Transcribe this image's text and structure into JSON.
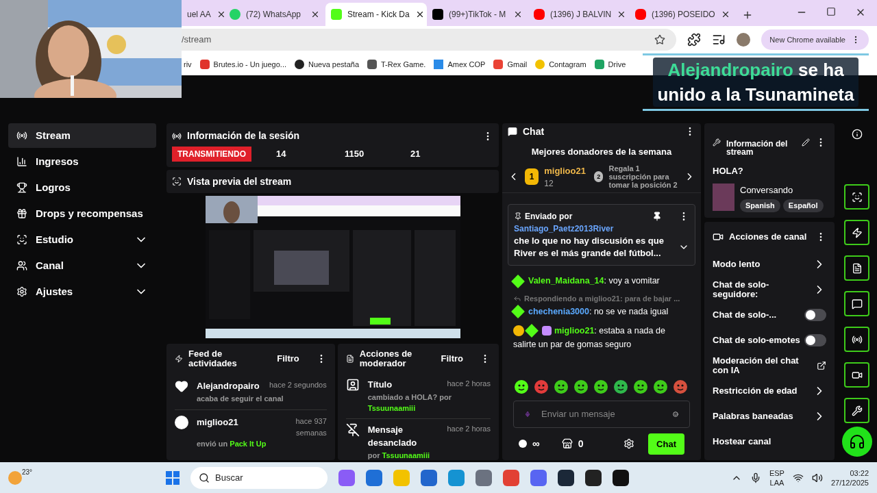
{
  "browser": {
    "tabs": [
      {
        "label": "uel AA",
        "selected": false
      },
      {
        "label": "(72) WhatsApp",
        "selected": false
      },
      {
        "label": "Stream - Kick Da",
        "selected": true
      },
      {
        "label": "(99+)TikTok - M",
        "selected": false
      },
      {
        "label": "(1396) J BALVIN",
        "selected": false
      },
      {
        "label": "(1396) POSEIDO",
        "selected": false
      }
    ],
    "address": "/stream",
    "update_button": "New Chrome available",
    "bookmarks": [
      "riv",
      "Brutes.io - Un juego...",
      "Nueva pestaña",
      "T-Rex Game.",
      "Amex COP",
      "Gmail",
      "Contagram",
      "Drive"
    ]
  },
  "alert": {
    "user": "Alejandropairo",
    "text": "se ha unido a la Tsunamineta"
  },
  "sidebar": {
    "items": [
      {
        "label": "Stream",
        "selected": true,
        "expandable": false
      },
      {
        "label": "Ingresos",
        "selected": false,
        "expandable": false
      },
      {
        "label": "Logros",
        "selected": false,
        "expandable": false
      },
      {
        "label": "Drops y recompensas",
        "selected": false,
        "expandable": false
      },
      {
        "label": "Estudio",
        "selected": false,
        "expandable": true
      },
      {
        "label": "Canal",
        "selected": false,
        "expandable": true
      },
      {
        "label": "Ajustes",
        "selected": false,
        "expandable": true
      }
    ]
  },
  "session": {
    "title": "Información de la sesión",
    "status": "TRANSMITIENDO",
    "stats": [
      "14",
      "1150",
      "21"
    ]
  },
  "preview": {
    "title": "Vista previa del stream"
  },
  "feed": {
    "title": "Feed de actividades",
    "filter": "Filtro",
    "items": [
      {
        "user": "Alejandropairo",
        "time": "hace 2 segundos",
        "text": "acaba de seguir el canal"
      },
      {
        "user": "miglioo21",
        "time": "hace 937 semanas",
        "text": "envió un",
        "highlight": "Pack It Up"
      }
    ]
  },
  "moderator": {
    "title": "Acciones de moderador",
    "filter": "Filtro",
    "items": [
      {
        "title": "Título",
        "time": "hace 2 horas",
        "text": "cambiado a **HOLA?** por",
        "by": "Tssuunaamiii"
      },
      {
        "title": "Mensaje desanclado",
        "time": "hace 2 horas",
        "text": "por",
        "by": "Tssuunaamiii"
      }
    ]
  },
  "chat": {
    "title": "Chat",
    "top_title": "Mejores donadores de la semana",
    "donor": {
      "rank": "1",
      "name": "miglioo21",
      "count": "12"
    },
    "next": {
      "rank": "2",
      "text": "Regala 1 suscripción para tomar la posición 2"
    },
    "pinned": {
      "label": "Enviado por",
      "user": "Santiago_Paetz2013River",
      "text": "che lo que no hay discusión es que River es el más grande del fútbol..."
    },
    "messages": [
      {
        "badges": [
          {
            "kind": "verified"
          }
        ],
        "user": "Valen_Maidana_14",
        "color": "#53fc18",
        "text": ": voy a vomitar"
      },
      {
        "reply": "Respondiendo a miglioo21: para de bajar ...",
        "badges": [
          {
            "kind": "verified"
          }
        ],
        "user": "chechenia3000",
        "color": "#5aa9ff",
        "text": ": no se ve nada igual"
      },
      {
        "badges": [
          {
            "kind": "rank"
          },
          {
            "kind": "verified"
          },
          {
            "kind": "gift"
          }
        ],
        "user": "miglioo21",
        "color": "#53fc18",
        "text": ": estaba a nada de salirte un par de gomas seguro"
      }
    ],
    "placeholder": "Enviar un mensaje",
    "points": "∞",
    "store_count": "0",
    "send": "Chat"
  },
  "stream_info": {
    "title": "Información del stream",
    "stream_title": "HOLA?",
    "category": "Conversando",
    "tags": [
      "Spanish",
      "Español"
    ]
  },
  "channel_actions": {
    "title": "Acciones de canal",
    "items": [
      {
        "label": "Modo lento",
        "kind": "arrow"
      },
      {
        "label": "Chat de solo-seguidore:",
        "kind": "arrow"
      },
      {
        "label": "Chat de solo-...",
        "kind": "toggle",
        "on": false
      },
      {
        "label": "Chat de solo-emotes",
        "kind": "toggle",
        "on": false
      },
      {
        "label": "Moderación del chat con IA",
        "kind": "external"
      },
      {
        "label": "Restricción de edad",
        "kind": "arrow"
      },
      {
        "label": "Palabras baneadas",
        "kind": "arrow"
      },
      {
        "label": "Hostear canal",
        "kind": "plain"
      }
    ]
  },
  "taskbar": {
    "weather": "23°",
    "search": "Buscar",
    "lang": "ESP",
    "layout": "LAA",
    "time": "03:22",
    "date": "27/12/2025"
  }
}
